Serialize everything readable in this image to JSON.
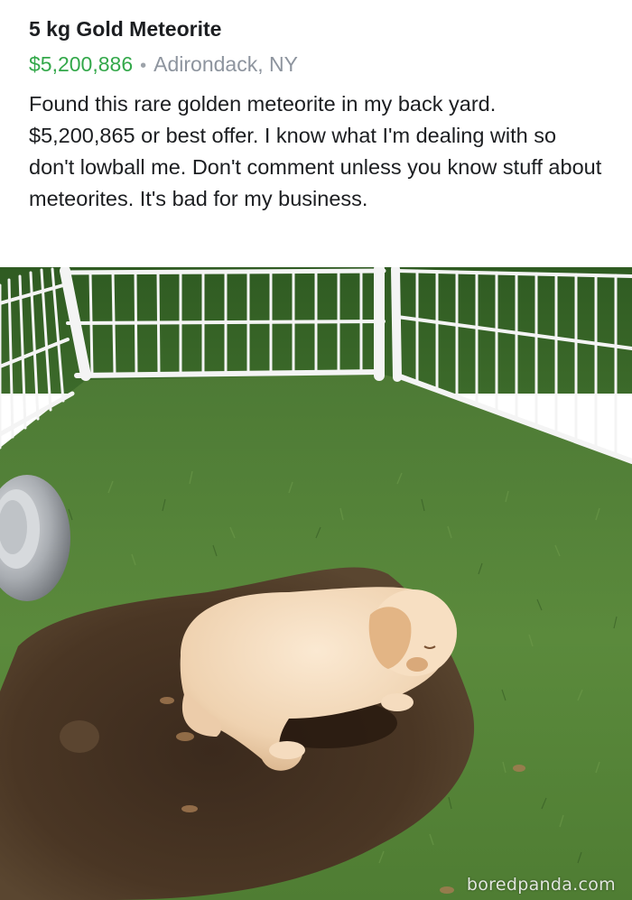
{
  "listing": {
    "title": "5 kg Gold Meteorite",
    "price": "$5,200,886",
    "separator": "•",
    "location": "Adirondack, NY",
    "description": "Found this rare golden meteorite in my back yard. $5,200,865 or best offer. I know what I'm dealing with so don't lowball me. Don't comment unless you know stuff about meteorites. It's bad for my business."
  },
  "photo": {
    "subject": "golden retriever puppy lying in a dug hole inside a white pen on grass",
    "watermark": "boredpanda.com"
  },
  "colors": {
    "price": "#33a84a",
    "location": "#8d949e",
    "text": "#1c1e21"
  }
}
